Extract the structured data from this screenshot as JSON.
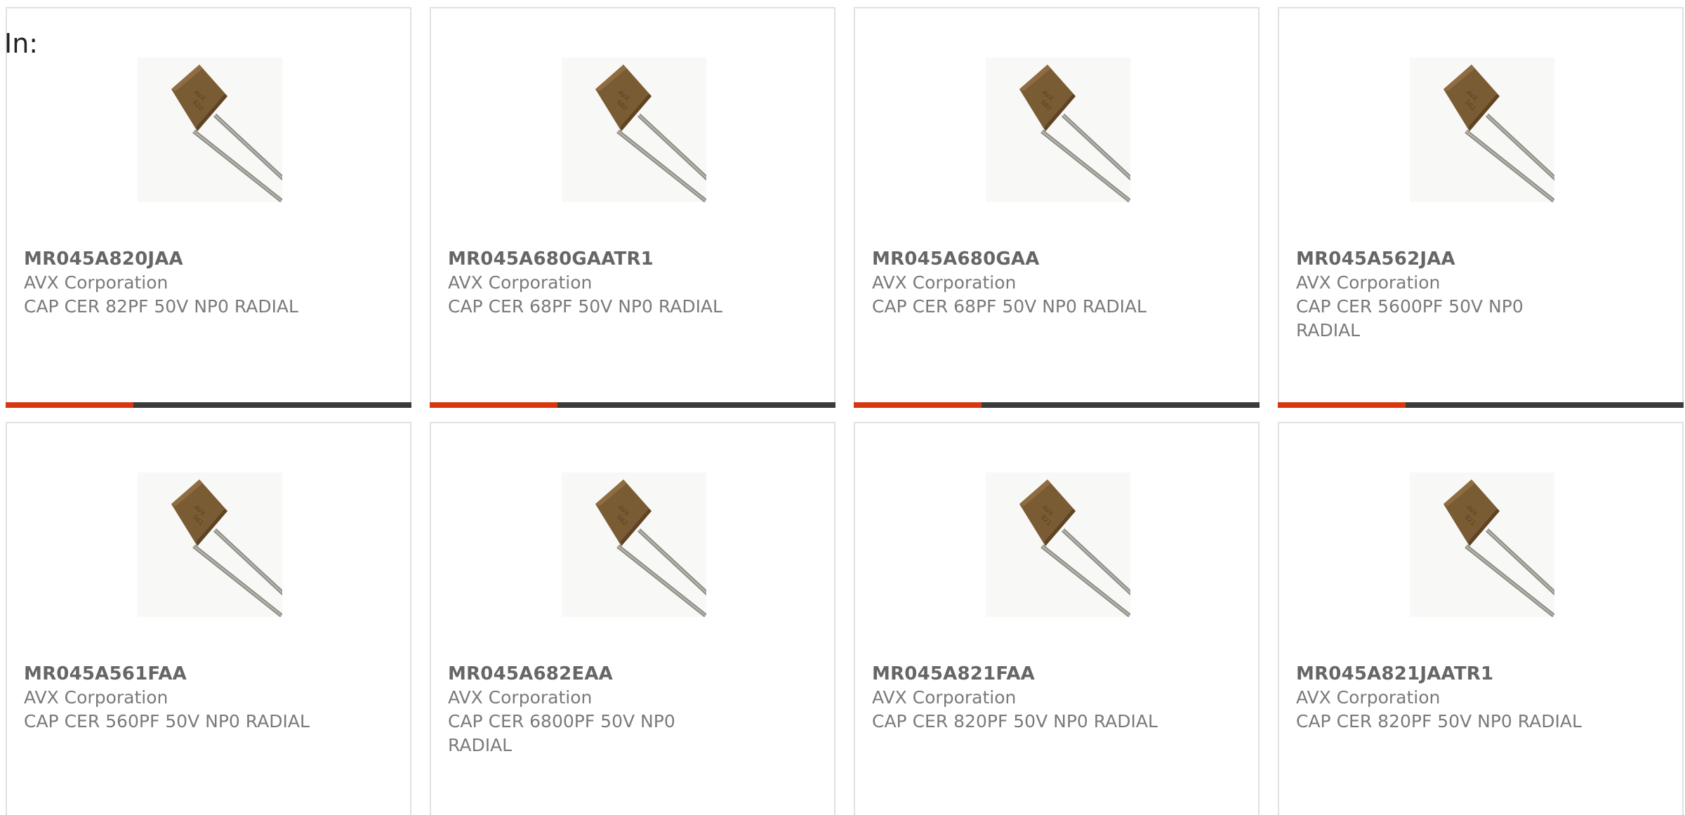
{
  "header": {
    "in_label": "In:"
  },
  "colors": {
    "accent": "#d9360f",
    "bar": "#3b3b3b",
    "border": "#e1e1e1",
    "text_bold": "#666666",
    "text": "#7a7a7a"
  },
  "products": [
    {
      "part_number": "MR045A820JAA",
      "manufacturer": "AVX Corporation",
      "description": "CAP CER 82PF 50V NP0 RADIAL",
      "image_icon": "radial-capacitor-icon",
      "show_bar": true
    },
    {
      "part_number": "MR045A680GAATR1",
      "manufacturer": "AVX Corporation",
      "description": "CAP CER 68PF 50V NP0 RADIAL",
      "image_icon": "radial-capacitor-icon",
      "show_bar": true
    },
    {
      "part_number": "MR045A680GAA",
      "manufacturer": "AVX Corporation",
      "description": "CAP CER 68PF 50V NP0 RADIAL",
      "image_icon": "radial-capacitor-icon",
      "show_bar": true
    },
    {
      "part_number": "MR045A562JAA",
      "manufacturer": "AVX Corporation",
      "description": "CAP CER 5600PF 50V NP0 RADIAL",
      "image_icon": "radial-capacitor-icon",
      "show_bar": true
    },
    {
      "part_number": "MR045A561FAA",
      "manufacturer": "AVX Corporation",
      "description": "CAP CER 560PF 50V NP0 RADIAL",
      "image_icon": "radial-capacitor-icon",
      "show_bar": false
    },
    {
      "part_number": "MR045A682EAA",
      "manufacturer": "AVX Corporation",
      "description": "CAP CER 6800PF 50V NP0 RADIAL",
      "image_icon": "radial-capacitor-icon",
      "show_bar": false
    },
    {
      "part_number": "MR045A821FAA",
      "manufacturer": "AVX Corporation",
      "description": "CAP CER 820PF 50V NP0 RADIAL",
      "image_icon": "radial-capacitor-icon",
      "show_bar": false
    },
    {
      "part_number": "MR045A821JAATR1",
      "manufacturer": "AVX Corporation",
      "description": "CAP CER 820PF 50V NP0 RADIAL",
      "image_icon": "radial-capacitor-icon",
      "show_bar": false
    }
  ]
}
